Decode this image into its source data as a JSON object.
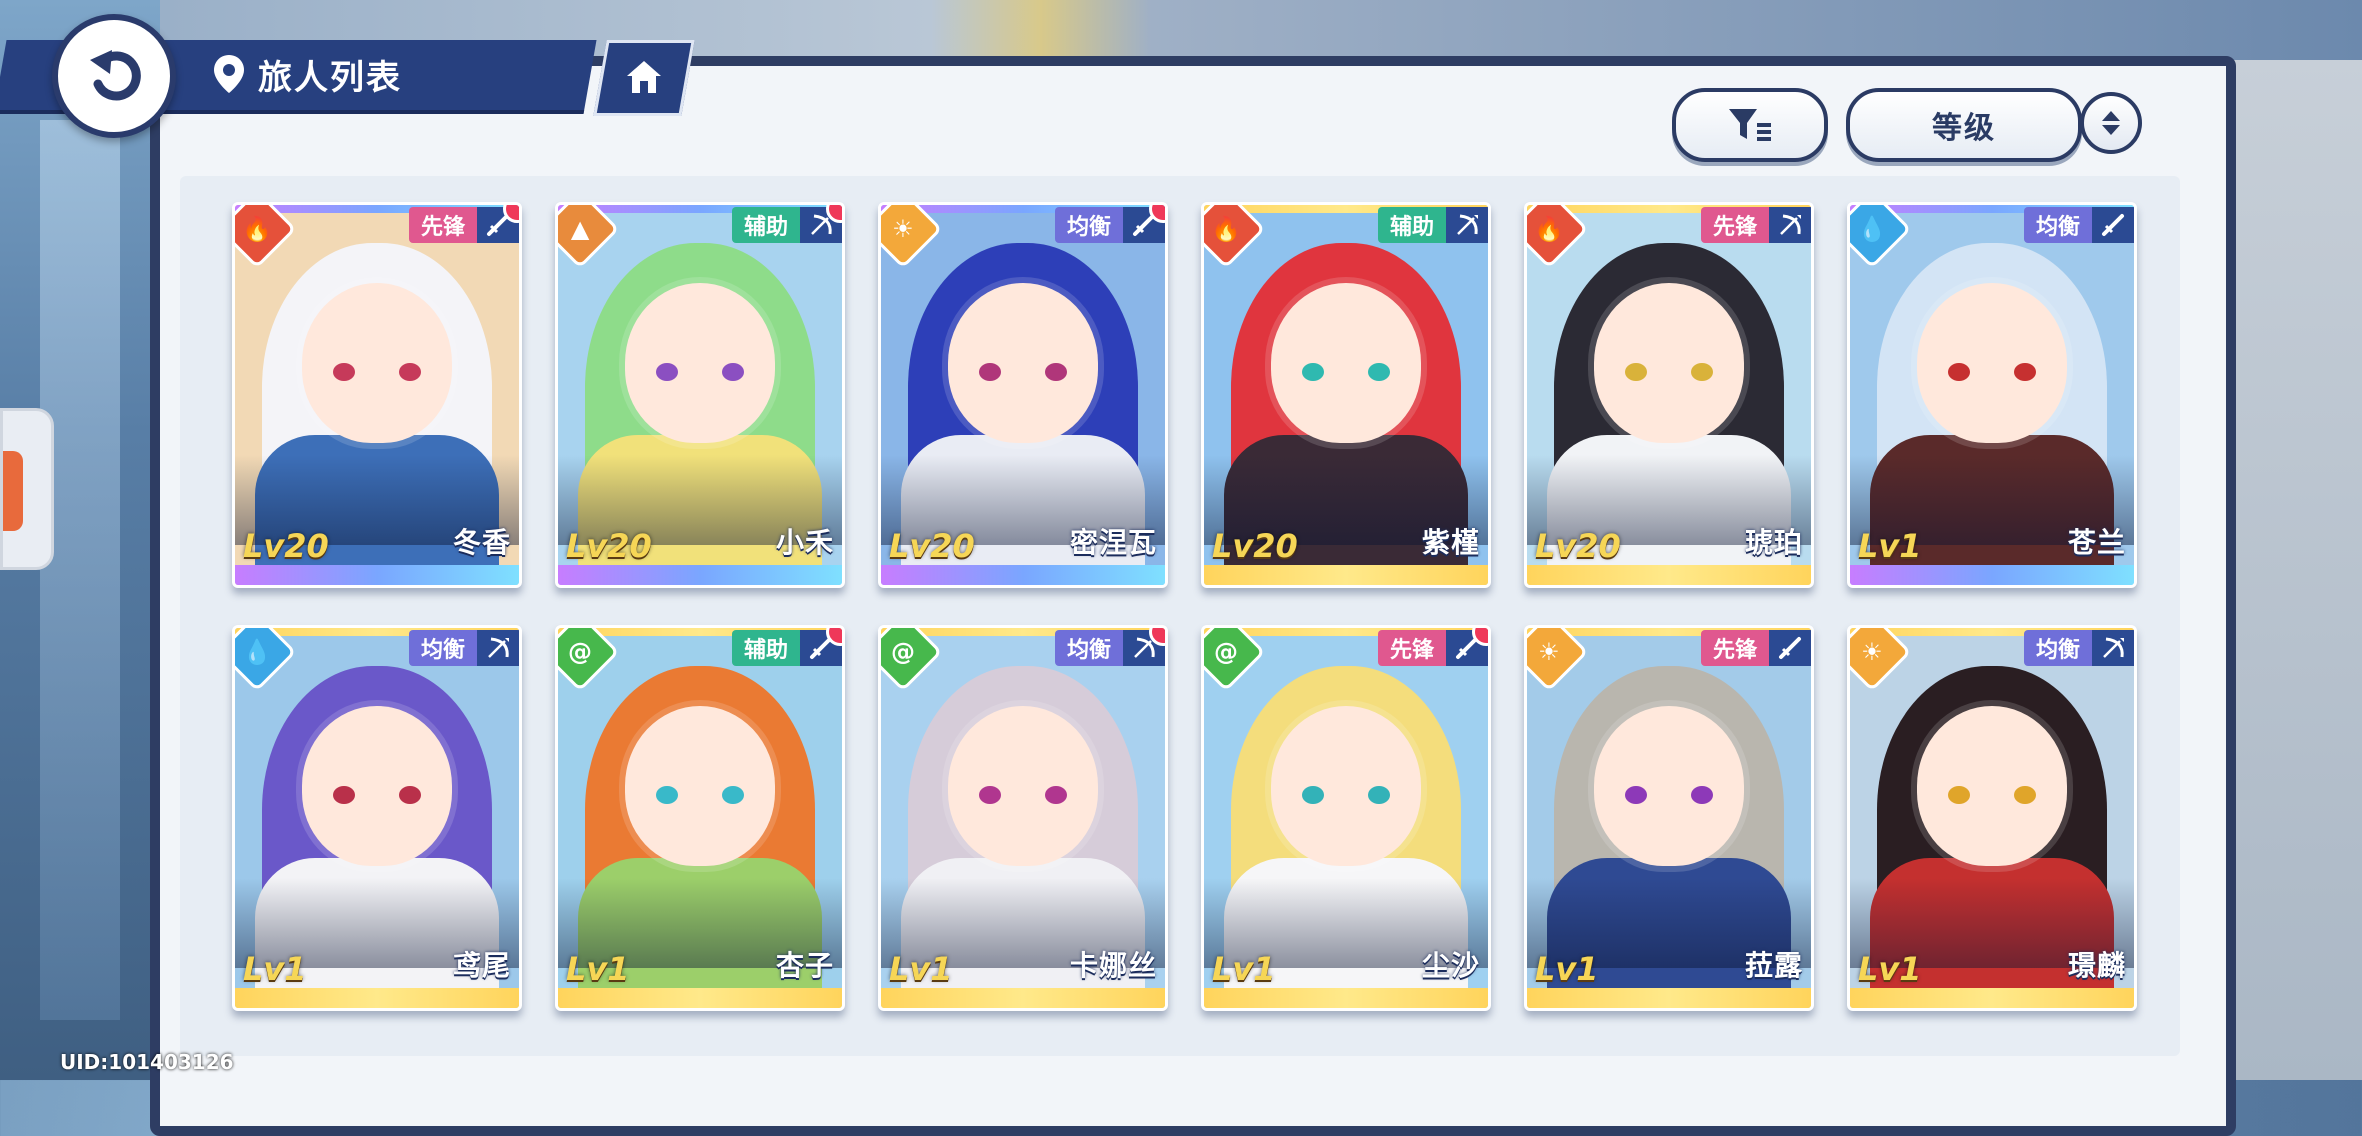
{
  "header": {
    "title": "旅人列表"
  },
  "controls": {
    "sort_label": "等级"
  },
  "colors": {
    "fire": "#e5513a",
    "earth": "#e88b3c",
    "light": "#f3a83a",
    "water": "#3aa7e6",
    "wind": "#47b84c",
    "vanguard": "#e0588f",
    "support": "#2fb58e",
    "balance": "#6f6fd9"
  },
  "cards": [
    {
      "name": "冬香",
      "level": "Lv20",
      "element": "fire",
      "element_icon": "fire-icon",
      "role": "先锋",
      "role_type": "vanguard",
      "weapon_icon": "sword-icon",
      "new": true,
      "rarity": "purple",
      "palette": {
        "bg": "#f2d9b5",
        "hair": "#f4f4f8",
        "body": "#3d6fb8",
        "eye": "#c63a5a"
      }
    },
    {
      "name": "小禾",
      "level": "Lv20",
      "element": "earth",
      "element_icon": "mountain-icon",
      "role": "辅助",
      "role_type": "support",
      "weapon_icon": "bow-icon",
      "new": true,
      "rarity": "purple",
      "palette": {
        "bg": "#a8d3ef",
        "hair": "#8edc8a",
        "body": "#f1e17a",
        "eye": "#8b4fc1"
      }
    },
    {
      "name": "密涅瓦",
      "level": "Lv20",
      "element": "light",
      "element_icon": "sun-icon",
      "role": "均衡",
      "role_type": "balance",
      "weapon_icon": "sword-icon",
      "new": true,
      "rarity": "purple",
      "palette": {
        "bg": "#8ab6e8",
        "hair": "#2d3fb8",
        "body": "#e9ecf4",
        "eye": "#b0367a"
      }
    },
    {
      "name": "紫槿",
      "level": "Lv20",
      "element": "fire",
      "element_icon": "fire-icon",
      "role": "辅助",
      "role_type": "support",
      "weapon_icon": "bow-icon",
      "new": false,
      "rarity": "gold",
      "palette": {
        "bg": "#8fc2ee",
        "hair": "#e0353e",
        "body": "#3a2a36",
        "eye": "#2fb9b0"
      }
    },
    {
      "name": "琥珀",
      "level": "Lv20",
      "element": "fire",
      "element_icon": "fire-icon",
      "role": "先锋",
      "role_type": "vanguard",
      "weapon_icon": "bow-icon",
      "new": false,
      "rarity": "gold",
      "palette": {
        "bg": "#b9dcef",
        "hair": "#2b2a34",
        "body": "#f1f3f6",
        "eye": "#d9b23a"
      }
    },
    {
      "name": "苍兰",
      "level": "Lv1",
      "element": "water",
      "element_icon": "water-drop-icon",
      "role": "均衡",
      "role_type": "balance",
      "weapon_icon": "sword-icon",
      "new": false,
      "rarity": "purple",
      "palette": {
        "bg": "#9fc9ec",
        "hair": "#d3e4f5",
        "body": "#5a2a2a",
        "eye": "#c63030"
      }
    },
    {
      "name": "鸢尾",
      "level": "Lv1",
      "element": "water",
      "element_icon": "water-drop-icon",
      "role": "均衡",
      "role_type": "balance",
      "weapon_icon": "bow-icon",
      "new": false,
      "rarity": "gold",
      "palette": {
        "bg": "#9cc8ea",
        "hair": "#6a58c9",
        "body": "#f3f3f6",
        "eye": "#b9304a"
      }
    },
    {
      "name": "杏子",
      "level": "Lv1",
      "element": "wind",
      "element_icon": "wind-icon",
      "role": "辅助",
      "role_type": "support",
      "weapon_icon": "sword-icon",
      "new": true,
      "rarity": "gold",
      "palette": {
        "bg": "#9ed0ec",
        "hair": "#ea7a33",
        "body": "#9ccf6a",
        "eye": "#39b9c9"
      }
    },
    {
      "name": "卡娜丝",
      "level": "Lv1",
      "element": "wind",
      "element_icon": "wind-icon",
      "role": "均衡",
      "role_type": "balance",
      "weapon_icon": "bow-icon",
      "new": true,
      "rarity": "gold",
      "palette": {
        "bg": "#a9d1ef",
        "hair": "#d6ccd9",
        "body": "#f0f0f4",
        "eye": "#b0368f"
      }
    },
    {
      "name": "尘沙",
      "level": "Lv1",
      "element": "wind",
      "element_icon": "wind-icon",
      "role": "先锋",
      "role_type": "vanguard",
      "weapon_icon": "sword-icon",
      "new": true,
      "rarity": "gold",
      "palette": {
        "bg": "#9fd0f0",
        "hair": "#f4dd7c",
        "body": "#f6f6f8",
        "eye": "#33b2b8"
      }
    },
    {
      "name": "菈露",
      "level": "Lv1",
      "element": "light",
      "element_icon": "sun-icon",
      "role": "先锋",
      "role_type": "vanguard",
      "weapon_icon": "sword-icon",
      "new": false,
      "rarity": "gold",
      "palette": {
        "bg": "#a3cbe9",
        "hair": "#b9b6ae",
        "body": "#2f4a93",
        "eye": "#8d39b8"
      }
    },
    {
      "name": "璟麟",
      "level": "Lv1",
      "element": "light",
      "element_icon": "sun-icon",
      "role": "均衡",
      "role_type": "balance",
      "weapon_icon": "bow-icon",
      "new": false,
      "rarity": "gold",
      "palette": {
        "bg": "#bcd3e6",
        "hair": "#2a1e22",
        "body": "#c4302f",
        "eye": "#e0a52a"
      }
    }
  ],
  "footer": {
    "uid": "UID:101403126"
  }
}
